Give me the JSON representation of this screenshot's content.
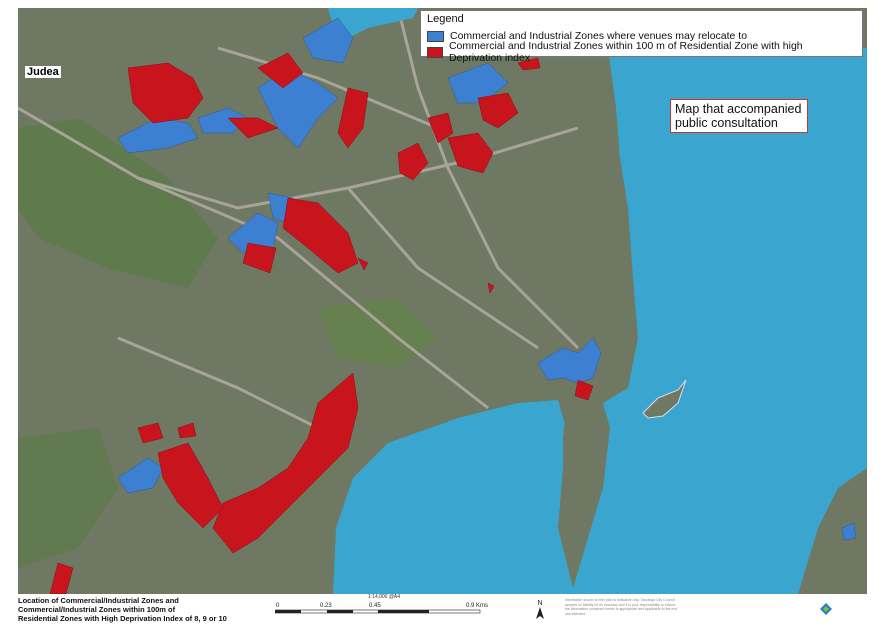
{
  "place_label": "Judea",
  "legend": {
    "title": "Legend",
    "items": [
      {
        "label": "Commercial and Industrial Zones where venues may relocate to",
        "color": "#3d7fd1"
      },
      {
        "label": "Commercial and Industrial Zones within 100 m of Residential Zone with high Deprivation index",
        "color": "#c8141c"
      }
    ]
  },
  "callout": "Map that accompanied public consultation",
  "footer": {
    "title_line1": "Location of Commercial/Industrial Zones and",
    "title_line2": "Commercial/Industrial Zones within 100m of",
    "title_line3": "Residential Zones with High Deprivation Index of 8, 9 or 10"
  },
  "scale": {
    "ratio": "1:14,000  @A4",
    "ticks": [
      "0",
      "0.23",
      "0.45",
      "0.9"
    ],
    "unit": "Kms"
  },
  "north": "N",
  "disclaimer": "Information shown on this plan is indicative only. Tauranga City Council accepts no liability for its accuracy and it is your responsibility to ensure the information contained herein is appropriate and applicable to the end use intended.",
  "logo": "Tauranga City",
  "colors": {
    "water": "#3aa6cf",
    "land": "#6f7862",
    "relocate": "#3d7fd1",
    "deprivation": "#c8141c"
  }
}
